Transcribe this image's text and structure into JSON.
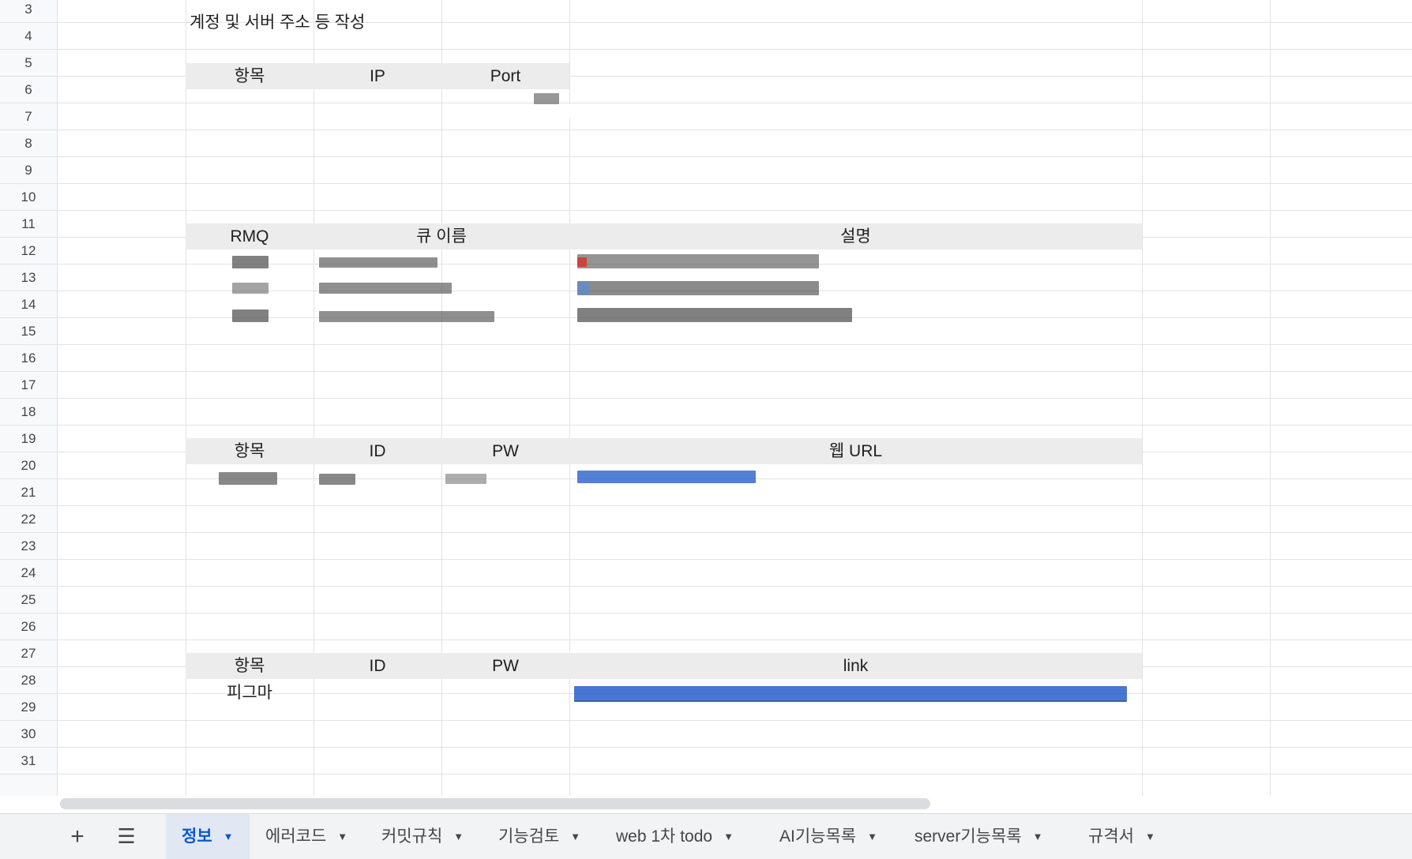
{
  "sheet": {
    "rows": [
      "3",
      "4",
      "5",
      "6",
      "7",
      "8",
      "9",
      "10",
      "11",
      "12",
      "13",
      "14",
      "15",
      "16",
      "17",
      "18",
      "19",
      "20",
      "21",
      "22",
      "23",
      "24",
      "25",
      "26",
      "27",
      "28",
      "29",
      "30",
      "31"
    ],
    "title_cell": "계정 및 서버 주소 등 작성",
    "table1_headers": [
      "항목",
      "IP",
      "Port"
    ],
    "table2_headers": [
      "RMQ",
      "큐 이름",
      "설명"
    ],
    "table3_headers": [
      "항목",
      "ID",
      "PW",
      "웹 URL"
    ],
    "table4_headers": [
      "항목",
      "ID",
      "PW",
      "link"
    ],
    "table4_row1_item": "피그마"
  },
  "toolbar": {
    "add_label": "+",
    "menu_label": "☰"
  },
  "tabs": [
    {
      "label": "정보",
      "active": true
    },
    {
      "label": "에러코드"
    },
    {
      "label": "커밋규칙"
    },
    {
      "label": "기능검토"
    },
    {
      "label": "web 1차 todo"
    },
    {
      "label": "AI기능목록"
    },
    {
      "label": "server기능목록"
    },
    {
      "label": "규격서"
    }
  ],
  "colors": {
    "accent": "#0b57d0",
    "header_fill": "#ececec",
    "link": "#1a55c9"
  }
}
